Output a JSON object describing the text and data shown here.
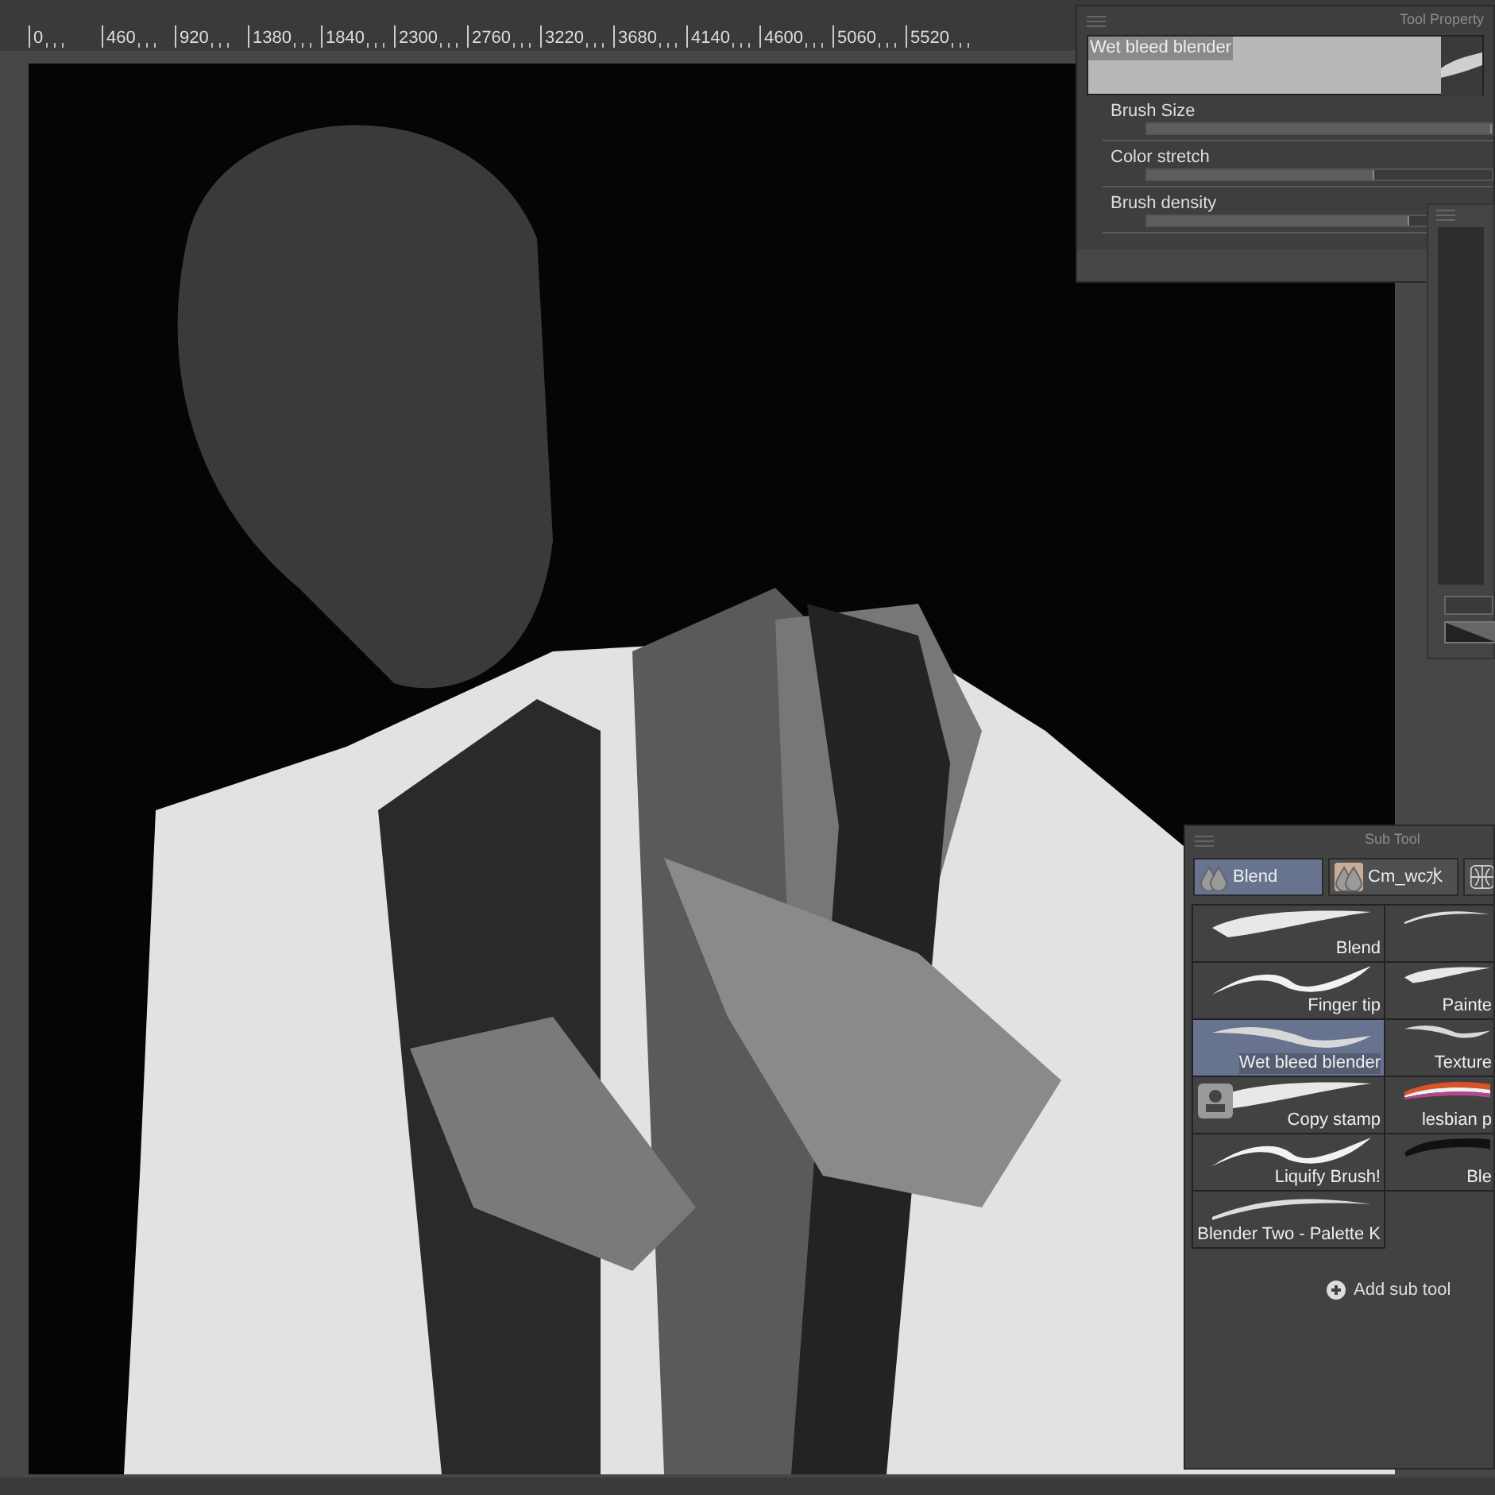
{
  "ruler": {
    "labels": [
      "0",
      "460",
      "920",
      "1380",
      "1840",
      "2300",
      "2760",
      "3220",
      "3680",
      "4140",
      "4600",
      "5060",
      "5520"
    ]
  },
  "tool_property": {
    "title": "Tool Property",
    "tool_name": "Wet bleed blender",
    "settings": [
      {
        "label": "Brush Size",
        "level": 1.0
      },
      {
        "label": "Color stretch",
        "level": 0.66
      },
      {
        "label": "Brush density",
        "level": 0.76
      }
    ]
  },
  "sub_tool": {
    "title": "Sub Tool",
    "tabs": [
      {
        "label": "Blend",
        "kind": "drops",
        "selected": true
      },
      {
        "label": "Cm_wc水",
        "kind": "drops",
        "selected": false
      },
      {
        "kind": "grid",
        "selected": false
      }
    ],
    "items": [
      {
        "label": "Blend",
        "kind": "soft",
        "selected": false
      },
      {
        "kind": "thin",
        "selected": false
      },
      {
        "label": "Finger tip",
        "kind": "taper",
        "selected": false
      },
      {
        "label": "Painte",
        "kind": "soft",
        "selected": false
      },
      {
        "label": "Wet bleed blender",
        "kind": "speckle",
        "selected": true
      },
      {
        "label": "Texture",
        "kind": "speckle",
        "selected": false
      },
      {
        "label": "Copy stamp",
        "kind": "stamp",
        "selected": false
      },
      {
        "label": "lesbian p",
        "kind": "rainbow",
        "selected": false
      },
      {
        "label": "Liquify Brush!",
        "kind": "taper",
        "selected": false
      },
      {
        "label": "Ble",
        "kind": "bristle",
        "selected": false
      },
      {
        "label": "Blender Two - Palette K",
        "kind": "thin",
        "selected": false
      }
    ],
    "add_label": "Add sub tool"
  }
}
